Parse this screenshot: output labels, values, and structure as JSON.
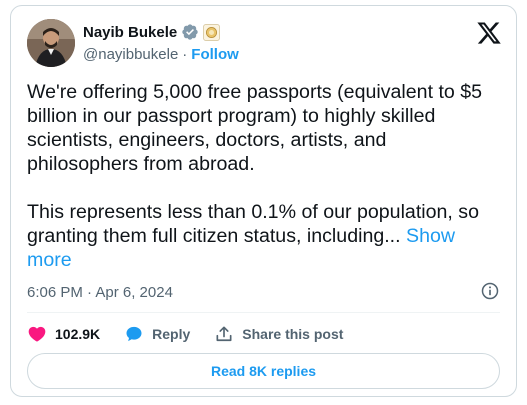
{
  "author": {
    "display_name": "Nayib Bukele",
    "handle": "@nayibbukele",
    "separator": "·",
    "follow_label": "Follow",
    "icons": [
      "verified-badge-icon",
      "government-seal-icon"
    ]
  },
  "tweet": {
    "text_part1": "We're offering 5,000 free passports (equivalent to $5 billion in our passport program) to highly skilled scientists, engineers, doctors, artists, and philosophers from abroad.",
    "text_part2": "This represents less than 0.1% of our population, so granting them full citizen status, including...",
    "show_more_label": "Show more",
    "timestamp": "6:06 PM · Apr 6, 2024"
  },
  "actions": {
    "like_count": "102.9K",
    "reply_label": "Reply",
    "share_label": "Share this post"
  },
  "footer": {
    "read_replies_label": "Read 8K replies"
  },
  "colors": {
    "accent": "#1d9bf0",
    "like": "#f91880",
    "text": "#0f1419",
    "muted": "#536471",
    "verified": "#829aab"
  }
}
